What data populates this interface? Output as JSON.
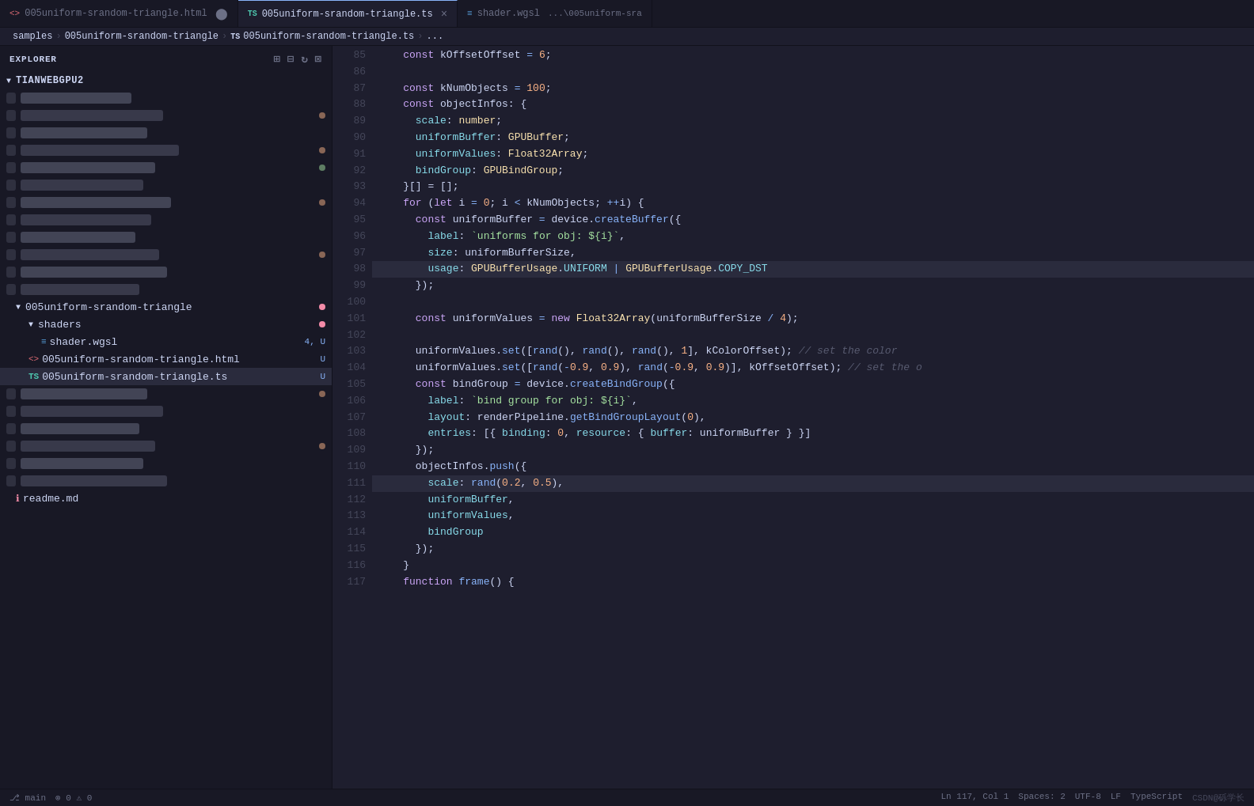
{
  "app": {
    "title": "EXPLORER"
  },
  "tabs": [
    {
      "id": "html-tab",
      "icon": "html",
      "label": "005uniform-srandom-triangle.html",
      "modified": true,
      "active": false
    },
    {
      "id": "ts-tab",
      "icon": "ts",
      "label": "005uniform-srandom-triangle.ts",
      "modified": true,
      "active": true,
      "closeable": true
    },
    {
      "id": "wgsl-tab",
      "icon": "wgsl",
      "label": "shader.wgsl",
      "path": "...\\005uniform-sra",
      "active": false
    }
  ],
  "breadcrumb": {
    "parts": [
      "samples",
      "005uniform-srandom-triangle",
      "005uniform-srandom-triangle.ts",
      "..."
    ]
  },
  "sidebar": {
    "title": "EXPLORER",
    "project": "TIANWEBGPU2",
    "folders": [
      {
        "name": "005uniform-srandom-triangle",
        "expanded": true,
        "badge": "red",
        "children": [
          {
            "name": "shaders",
            "expanded": true,
            "badge": "red",
            "children": [
              {
                "name": "shader.wgsl",
                "badge": "4u",
                "type": "wgsl"
              }
            ]
          },
          {
            "name": "005uniform-srandom-triangle.html",
            "badge": "u",
            "type": "html"
          },
          {
            "name": "005uniform-srandom-triangle.ts",
            "badge": "u",
            "type": "ts",
            "active": true
          }
        ]
      }
    ]
  },
  "lines": [
    {
      "num": 85,
      "code": "    const kOffsetOffset = 6;"
    },
    {
      "num": 86,
      "code": ""
    },
    {
      "num": 87,
      "code": "    const kNumObjects = 100;"
    },
    {
      "num": 88,
      "code": "    const objectInfos: {"
    },
    {
      "num": 89,
      "code": "      scale: number;"
    },
    {
      "num": 90,
      "code": "      uniformBuffer: GPUBuffer;"
    },
    {
      "num": 91,
      "code": "      uniformValues: Float32Array;"
    },
    {
      "num": 92,
      "code": "      bindGroup: GPUBindGroup;"
    },
    {
      "num": 93,
      "code": "    }[] = [];"
    },
    {
      "num": 94,
      "code": "    for (let i = 0; i < kNumObjects; ++i) {"
    },
    {
      "num": 95,
      "code": "      const uniformBuffer = device.createBuffer({"
    },
    {
      "num": 96,
      "code": "        label: `uniforms for obj: ${i}`,"
    },
    {
      "num": 97,
      "code": "        size: uniformBufferSize,"
    },
    {
      "num": 98,
      "code": "        usage: GPUBufferUsage.UNIFORM | GPUBufferUsage.COPY_DST"
    },
    {
      "num": 99,
      "code": "      });"
    },
    {
      "num": 100,
      "code": ""
    },
    {
      "num": 101,
      "code": "      const uniformValues = new Float32Array(uniformBufferSize / 4);"
    },
    {
      "num": 102,
      "code": ""
    },
    {
      "num": 103,
      "code": "      uniformValues.set([rand(), rand(), rand(), 1], kColorOffset); // set the color"
    },
    {
      "num": 104,
      "code": "      uniformValues.set([rand(-0.9, 0.9), rand(-0.9, 0.9)], kOffsetOffset); // set the o"
    },
    {
      "num": 105,
      "code": "      const bindGroup = device.createBindGroup({"
    },
    {
      "num": 106,
      "code": "        label: `bind group for obj: ${i}`,"
    },
    {
      "num": 107,
      "code": "        layout: renderPipeline.getBindGroupLayout(0),"
    },
    {
      "num": 108,
      "code": "        entries: [{ binding: 0, resource: { buffer: uniformBuffer } }]"
    },
    {
      "num": 109,
      "code": "      });"
    },
    {
      "num": 110,
      "code": "      objectInfos.push({"
    },
    {
      "num": 111,
      "code": "        scale: rand(0.2, 0.5),"
    },
    {
      "num": 112,
      "code": "        uniformBuffer,"
    },
    {
      "num": 113,
      "code": "        uniformValues,"
    },
    {
      "num": 114,
      "code": "        bindGroup"
    },
    {
      "num": 115,
      "code": "      });"
    },
    {
      "num": 116,
      "code": "    }"
    },
    {
      "num": 117,
      "code": "    function frame() {"
    }
  ],
  "status": {
    "branch": "main",
    "errors": "0",
    "warnings": "0",
    "encoding": "UTF-8",
    "lineending": "LF",
    "language": "TypeScript",
    "position": "Ln 117, Col 1",
    "spaces": "Spaces: 2",
    "attribution": "CSDN@砾学长"
  }
}
